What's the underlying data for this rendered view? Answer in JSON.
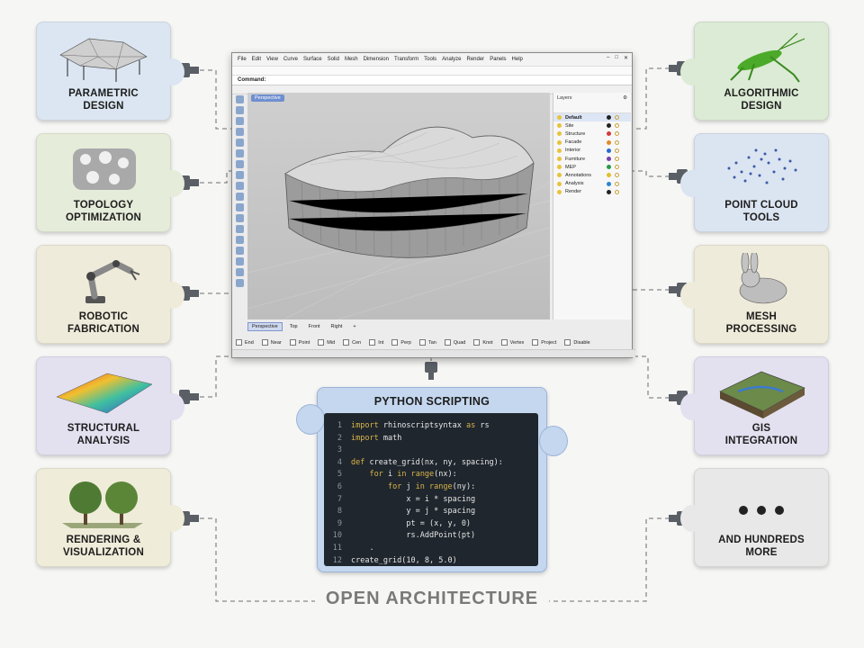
{
  "footer_title": "OPEN ARCHITECTURE",
  "modules": {
    "left": [
      {
        "title": "PARAMETRIC\nDESIGN",
        "color": "#dbe6f2",
        "icon": "parametric-roof-icon"
      },
      {
        "title": "TOPOLOGY\nOPTIMIZATION",
        "color": "#e5ecda",
        "icon": "lattice-structure-icon"
      },
      {
        "title": "ROBOTIC\nFABRICATION",
        "color": "#efebda",
        "icon": "robot-arm-icon"
      },
      {
        "title": "STRUCTURAL\nANALYSIS",
        "color": "#e3e0f0",
        "icon": "heatmap-surface-icon"
      },
      {
        "title": "RENDERING &\nVISUALIZATION",
        "color": "#efecd9",
        "icon": "trees-icon"
      }
    ],
    "right": [
      {
        "title": "ALGORITHMIC\nDESIGN",
        "color": "#dcebd5",
        "icon": "grasshopper-icon"
      },
      {
        "title": "POINT CLOUD\nTOOLS",
        "color": "#dbe4f1",
        "icon": "point-cloud-icon"
      },
      {
        "title": "MESH\nPROCESSING",
        "color": "#efebda",
        "icon": "mesh-bunny-icon"
      },
      {
        "title": "GIS\nINTEGRATION",
        "color": "#e3e0f0",
        "icon": "terrain-map-icon"
      },
      {
        "title": "AND HUNDREDS\nMORE",
        "color": "#e8e8e8",
        "icon": "ellipsis-icon"
      }
    ]
  },
  "app": {
    "menu": [
      "File",
      "Edit",
      "View",
      "Curve",
      "Surface",
      "Solid",
      "Mesh",
      "Dimension",
      "Transform",
      "Tools",
      "Analyze",
      "Render",
      "Panels",
      "Help"
    ],
    "command_label": "Command:",
    "viewport_label": "Perspective",
    "layers_title": "Layers",
    "layers": [
      {
        "name": "Default",
        "color": "#222222",
        "active": true
      },
      {
        "name": "Site",
        "color": "#222222"
      },
      {
        "name": "Structure",
        "color": "#d23b3b"
      },
      {
        "name": "Facade",
        "color": "#e08a2a"
      },
      {
        "name": "Interior",
        "color": "#2a6ad0"
      },
      {
        "name": "Furniture",
        "color": "#7a3fb0"
      },
      {
        "name": "MEP",
        "color": "#2a9a4a"
      },
      {
        "name": "Annotations",
        "color": "#e0c02a"
      },
      {
        "name": "Analysis",
        "color": "#2a86d0"
      },
      {
        "name": "Render",
        "color": "#222222"
      }
    ],
    "view_tabs": [
      "Perspective",
      "Top",
      "Front",
      "Right",
      "+"
    ],
    "osnaps": [
      "End",
      "Near",
      "Point",
      "Mid",
      "Cen",
      "Int",
      "Perp",
      "Tan",
      "Quad",
      "Knot",
      "Vertex",
      "Project",
      "Disable"
    ]
  },
  "python": {
    "title": "PYTHON SCRIPTING",
    "code": [
      "import rhinoscriptsyntax as rs",
      "import math",
      "",
      "def create_grid(nx, ny, spacing):",
      "    for i in range(nx):",
      "        for j in range(ny):",
      "            x = i * spacing",
      "            y = j * spacing",
      "            pt = (x, y, 0)",
      "            rs.AddPoint(pt)",
      "    .",
      "create_grid(10, 8, 5.0)"
    ]
  }
}
